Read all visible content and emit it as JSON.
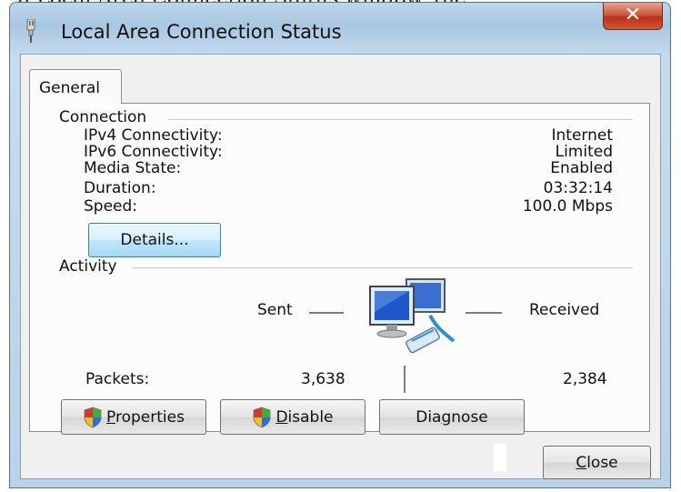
{
  "window": {
    "title": "Local Area Connection Status"
  },
  "top_strip_text": "a   Local Area Connection Status window, the",
  "tabs": [
    {
      "label": "General"
    }
  ],
  "connection": {
    "group_label": "Connection",
    "rows": [
      {
        "label": "IPv4 Connectivity:",
        "value": "Internet"
      },
      {
        "label": "IPv6 Connectivity:",
        "value": "Limited"
      },
      {
        "label": "Media State:",
        "value": "Enabled"
      },
      {
        "label": "Duration:",
        "value": "03:32:14"
      },
      {
        "label": "Speed:",
        "value": "100.0 Mbps"
      }
    ],
    "details_button": "Details..."
  },
  "activity": {
    "group_label": "Activity",
    "sent_label": "Sent",
    "received_label": "Received",
    "packets_label": "Packets:",
    "packets_sent": "3,638",
    "packets_received": "2,384"
  },
  "buttons": {
    "properties": {
      "first": "P",
      "rest": "roperties"
    },
    "disable": {
      "first": "D",
      "rest": "isable"
    },
    "diagnose": {
      "pre": "Dia",
      "mn": "g",
      "post": "nose"
    },
    "close": {
      "first": "C",
      "rest": "lose"
    }
  },
  "icons": {
    "title": "network-adapter-icon",
    "network": "network-computers-icon",
    "shield": "uac-shield-icon",
    "close": "close-icon"
  }
}
